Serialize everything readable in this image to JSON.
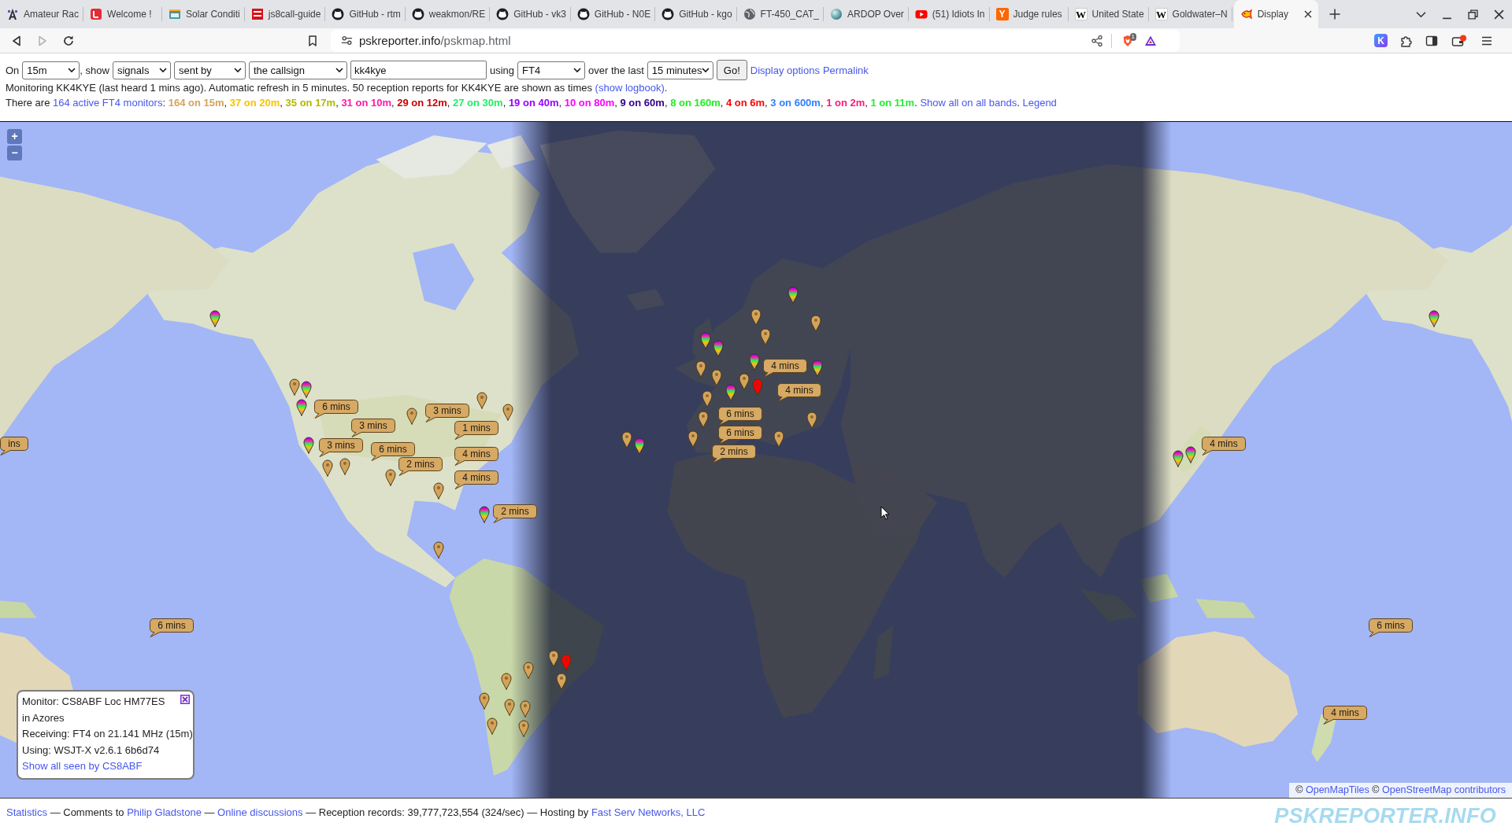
{
  "browser": {
    "tabs": [
      {
        "title": "Amateur Rac",
        "kind": "tower",
        "selected": false
      },
      {
        "title": "Welcome !",
        "kind": "square",
        "selected": false
      },
      {
        "title": "Solar Conditi",
        "kind": "panel",
        "selected": false
      },
      {
        "title": "js8call-guide",
        "kind": "club",
        "selected": false
      },
      {
        "title": "GitHub - rtm",
        "kind": "cat",
        "selected": false
      },
      {
        "title": "weakmon/RE",
        "kind": "cat",
        "selected": false
      },
      {
        "title": "GitHub - vk3",
        "kind": "cat",
        "selected": false
      },
      {
        "title": "GitHub - N0E",
        "kind": "cat",
        "selected": false
      },
      {
        "title": "GitHub - kgo",
        "kind": "cat",
        "selected": false
      },
      {
        "title": "FT-450_CAT_",
        "kind": "globe",
        "selected": false
      },
      {
        "title": "ARDOP Over",
        "kind": "sphere",
        "selected": false
      },
      {
        "title": "(51) Idiots In",
        "kind": "video",
        "selected": false
      },
      {
        "title": "Judge rules",
        "kind": "letter",
        "glyph": "Y",
        "selected": false
      },
      {
        "title": "United State",
        "kind": "wiki",
        "glyph": "W",
        "selected": false
      },
      {
        "title": "Goldwater–N",
        "kind": "wiki",
        "glyph": "W",
        "selected": false
      },
      {
        "title": "Display",
        "kind": "fish",
        "selected": true
      }
    ],
    "forward_disabled": true,
    "address": {
      "host": "pskreporter.info",
      "path": "/pskmap.html"
    },
    "shield_badge": "1",
    "extension_glyph": "K"
  },
  "controls": {
    "on_label": "On",
    "band": "15m",
    "show_label": ", show",
    "show": "signals",
    "direction": "sent by",
    "target": "the callsign",
    "callsign": "kk4kye",
    "using_label": "using",
    "mode": "FT4",
    "period_label": "over the last",
    "period": "15 minutes",
    "go_button": "Go!",
    "links": [
      "Display options",
      "Permalink"
    ]
  },
  "status": {
    "text": "Monitoring KK4KYE (last heard 1 mins ago). Automatic refresh in 5 minutes. 50 reception reports for KK4KYE are shown as times",
    "link": "(show logbook)",
    "end": "."
  },
  "monitors": {
    "intro": "There are",
    "link": "164 active FT4 monitors",
    "colon": ":",
    "bands": [
      {
        "label": "164 on 15m",
        "color": "#d4a35a"
      },
      {
        "label": "37 on 20m",
        "color": "#f5c400"
      },
      {
        "label": "35 on 17m",
        "color": "#b3b800"
      },
      {
        "label": "31 on 10m",
        "color": "#ff1aa3"
      },
      {
        "label": "29 on 12m",
        "color": "#cc0000"
      },
      {
        "label": "27 on 30m",
        "color": "#22ee66"
      },
      {
        "label": "19 on 40m",
        "color": "#9400ff"
      },
      {
        "label": "10 on 80m",
        "color": "#ff00ff"
      },
      {
        "label": "9 on 60m",
        "color": "#330088"
      },
      {
        "label": "8 on 160m",
        "color": "#22ee22"
      },
      {
        "label": "4 on 6m",
        "color": "#ff0000"
      },
      {
        "label": "3 on 600m",
        "color": "#2f7fff"
      },
      {
        "label": "1 on 2m",
        "color": "#ff1a70"
      },
      {
        "label": "1 on 11m",
        "color": "#22ee33"
      }
    ],
    "separator": ",",
    "end": ".",
    "all_bands_link": "Show all on all bands",
    "all_bands_end": ".",
    "legend_link": "Legend"
  },
  "map": {
    "zoom_in": "+",
    "zoom_out": "−",
    "markers": [
      {
        "kind": "multi"
      },
      {
        "kind": "multi"
      },
      {
        "kind": "single",
        "color": "#d4a35a"
      },
      {
        "kind": "multi"
      },
      {
        "kind": "multi"
      },
      {
        "kind": "multi"
      },
      {
        "kind": "single",
        "color": "#d4a35a"
      },
      {
        "kind": "single",
        "color": "#d4a35a"
      },
      {
        "kind": "single",
        "color": "#d4a35a"
      },
      {
        "kind": "single",
        "color": "#d4a35a"
      },
      {
        "kind": "single",
        "color": "#d4a35a"
      },
      {
        "kind": "single",
        "color": "#d4a35a"
      },
      {
        "kind": "single",
        "color": "#d4a35a"
      },
      {
        "kind": "multi"
      },
      {
        "kind": "single",
        "color": "#d4a35a"
      },
      {
        "kind": "single",
        "color": "#d4a35a"
      },
      {
        "kind": "multi"
      },
      {
        "kind": "multi"
      },
      {
        "kind": "multi"
      },
      {
        "kind": "single",
        "color": "#d4a35a"
      },
      {
        "kind": "single",
        "color": "#d4a35a"
      },
      {
        "kind": "multi"
      },
      {
        "kind": "single",
        "color": "#ff0000"
      },
      {
        "kind": "single",
        "color": "#d4a35a"
      },
      {
        "kind": "multi"
      },
      {
        "kind": "single",
        "color": "#d4a35a"
      },
      {
        "kind": "single",
        "color": "#d4a35a"
      },
      {
        "kind": "single",
        "color": "#d4a35a"
      },
      {
        "kind": "single",
        "color": "#d4a35a"
      },
      {
        "kind": "single",
        "color": "#d4a35a"
      },
      {
        "kind": "multi"
      },
      {
        "kind": "single",
        "color": "#d4a35a"
      },
      {
        "kind": "single",
        "color": "#d4a35a"
      },
      {
        "kind": "single",
        "color": "#d4a35a"
      },
      {
        "kind": "multi"
      },
      {
        "kind": "multi"
      },
      {
        "kind": "multi"
      },
      {
        "kind": "single",
        "color": "#d4a35a"
      },
      {
        "kind": "single",
        "color": "#ff0000"
      },
      {
        "kind": "single",
        "color": "#d4a35a"
      },
      {
        "kind": "single",
        "color": "#d4a35a"
      },
      {
        "kind": "single",
        "color": "#d4a35a"
      },
      {
        "kind": "single",
        "color": "#d4a35a"
      },
      {
        "kind": "single",
        "color": "#d4a35a"
      },
      {
        "kind": "single",
        "color": "#d4a35a"
      },
      {
        "kind": "single",
        "color": "#d4a35a"
      },
      {
        "kind": "single",
        "color": "#d4a35a"
      }
    ],
    "time_labels": [
      "ins",
      "6 mins",
      "3 mins",
      "3 mins",
      "6 mins",
      "3 mins",
      "1 mins",
      "4 mins",
      "2 mins",
      "4 mins",
      "2 mins",
      "6 mins",
      "4 mins",
      "4 mins",
      "6 mins",
      "6 mins",
      "2 mins",
      "4 mins",
      "6 mins",
      "4 mins"
    ],
    "popup": {
      "lines": [
        "Monitor: CS8ABF Loc HM77ES",
        "in Azores",
        "Receiving: FT4 on 21.141 MHz (15m)",
        "Using: WSJT-X v2.6.1 6b6d74"
      ],
      "link": "Show all seen by CS8ABF"
    },
    "attribution": [
      {
        "kind": "text",
        "text": "©"
      },
      {
        "kind": "link",
        "text": "OpenMapTiles"
      },
      {
        "kind": "text",
        "text": "©"
      },
      {
        "kind": "link",
        "text": "OpenStreetMap contributors"
      }
    ]
  },
  "footer": {
    "segments": [
      {
        "kind": "link",
        "text": "Statistics"
      },
      {
        "kind": "text",
        "text": "— Comments to"
      },
      {
        "kind": "link",
        "text": "Philip Gladstone"
      },
      {
        "kind": "text",
        "text": "—"
      },
      {
        "kind": "link",
        "text": "Online discussions"
      },
      {
        "kind": "text",
        "text": "— Reception records: 39,777,723,554 (324/sec) — Hosting by"
      },
      {
        "kind": "link",
        "text": "Fast Serv Networks, LLC"
      }
    ],
    "logo": "PSKREPORTER.INFO"
  }
}
